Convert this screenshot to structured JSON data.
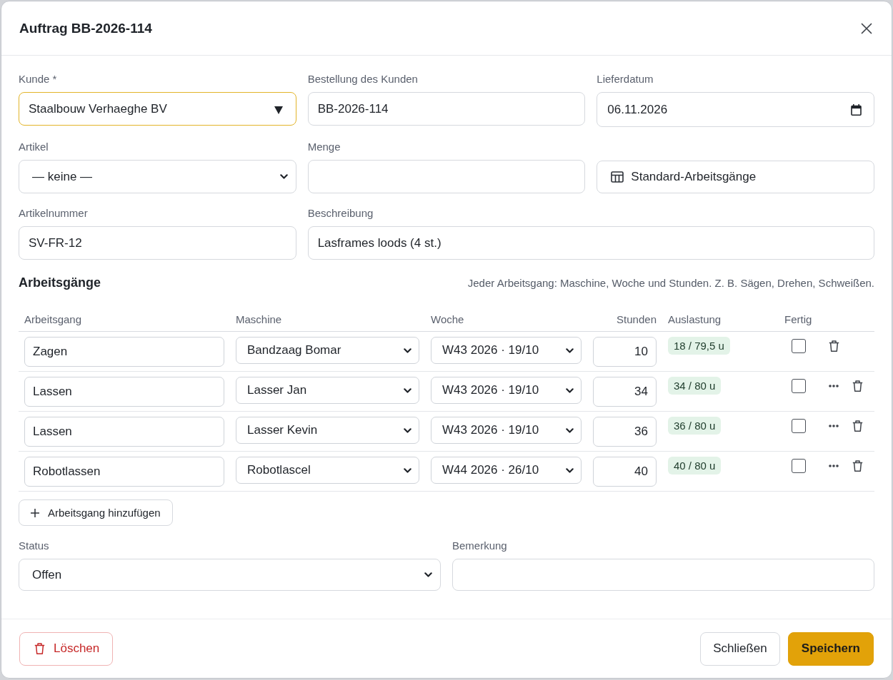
{
  "dialog": {
    "title": "Auftrag BB-2026-114"
  },
  "fields": [
    {
      "kind": "combo",
      "label": "Kunde *",
      "value": "Staalbouw Verhaeghe BV",
      "focused": true
    },
    {
      "kind": "text",
      "label": "Bestellung des Kunden",
      "value": "BB-2026-114",
      "focused": false
    },
    {
      "kind": "date",
      "label": "Lieferdatum",
      "value": "06.11.2026",
      "focused": false
    },
    {
      "kind": "select",
      "label": "Artikel",
      "value": "— keine —",
      "focused": false
    },
    {
      "kind": "text",
      "label": "Menge",
      "focused": false
    },
    {
      "kind": "action",
      "text": "Standard-Arbeitsgänge"
    },
    {
      "kind": "text",
      "label": "Artikelnummer",
      "value": "SV-FR-12",
      "focused": false
    },
    {
      "kind": "text",
      "label": "Beschreibung",
      "value": "Lasframes loods (4 st.)",
      "focused": false
    }
  ],
  "operations": {
    "title": "Arbeitsgänge",
    "hint": "Jeder Arbeitsgang: Maschine, Woche und Stunden. Z. B. Sägen, Drehen, Schweißen.",
    "columns": [
      "Arbeitsgang",
      "Maschine",
      "Woche",
      "Stunden",
      "Auslastung",
      "Fertig"
    ],
    "rows": [
      {
        "name": "Zagen",
        "machine": "Bandzaag Bomar",
        "week": "W43 2026 · 19/10",
        "hours": "10",
        "load": "18 / 79,5 u",
        "done": false,
        "menu": false
      },
      {
        "name": "Lassen",
        "machine": "Lasser Jan",
        "week": "W43 2026 · 19/10",
        "hours": "34",
        "load": "34 / 80 u",
        "done": false,
        "menu": true
      },
      {
        "name": "Lassen",
        "machine": "Lasser Kevin",
        "week": "W43 2026 · 19/10",
        "hours": "36",
        "load": "36 / 80 u",
        "done": false,
        "menu": true
      },
      {
        "name": "Robotlassen",
        "machine": "Robotlascel",
        "week": "W44 2026 · 26/10",
        "hours": "40",
        "load": "40 / 80 u",
        "done": false,
        "menu": true
      }
    ],
    "add_button": "Arbeitsgang hinzufügen"
  },
  "bottom_fields": [
    {
      "kind": "select",
      "label": "Status",
      "value": "Offen",
      "focused": false
    },
    {
      "kind": "text",
      "label": "Bemerkung",
      "focused": false
    }
  ],
  "footer": {
    "delete_button": "Löschen",
    "close_button": "Schließen",
    "save_button": "Speichern"
  }
}
